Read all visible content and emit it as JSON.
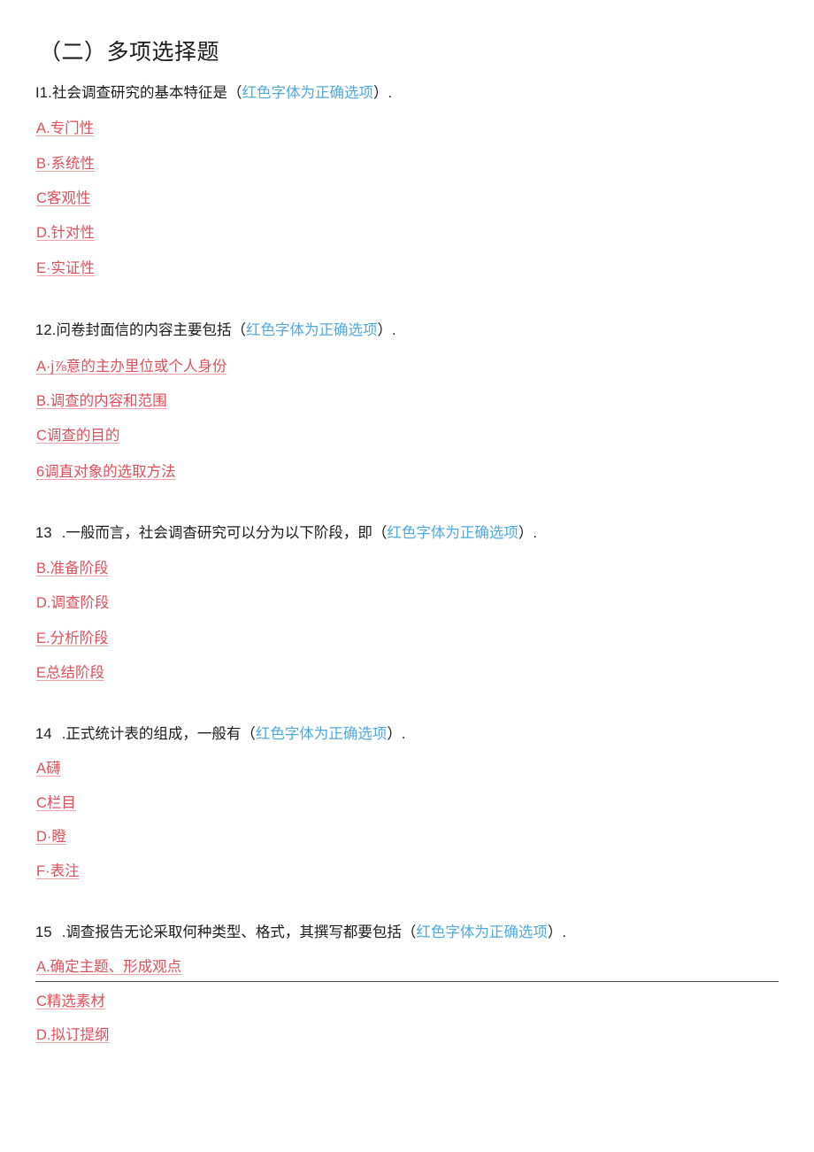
{
  "section": {
    "title": "（二）多项选择题"
  },
  "annotation": {
    "open_paren": "（",
    "text": "红色字体为正确选项",
    "close_paren": "）",
    "period": ".",
    "color": "#4fa9dd"
  },
  "option_color": "#e0505a",
  "questions": [
    {
      "number": "I1.",
      "stem": "社会调查研究的基本特征是",
      "spaced_number": false,
      "options": [
        {
          "label": "A.专门性",
          "underlined": true
        },
        {
          "label": "B·系统性",
          "underlined": true
        },
        {
          "label": "C客观性",
          "underlined": true
        },
        {
          "label": "D.针对性",
          "underlined": true
        },
        {
          "label": "E·实证性",
          "underlined": true
        }
      ]
    },
    {
      "number": "12.",
      "stem": "问卷封面信的内容主要包括",
      "spaced_number": false,
      "options": [
        {
          "label": "A·j⅞意的主办里位或个人身份",
          "underlined": true
        },
        {
          "label": "B.调查的内容和范围",
          "underlined": true
        },
        {
          "label": "C调查的目的",
          "underlined": true
        },
        {
          "label": "6调直对象的选取方法",
          "underlined": true
        }
      ]
    },
    {
      "number": "13",
      "stem": ".一般而言，社会调杳研究可以分为以下阶段，即",
      "spaced_number": true,
      "options": [
        {
          "label": "B.准备阶段",
          "underlined": true
        },
        {
          "label": "D.调查阶段",
          "underlined": false
        },
        {
          "label": "E.分析阶段",
          "underlined": true
        },
        {
          "label": "E总结阶段",
          "underlined": true
        }
      ]
    },
    {
      "number": "14",
      "stem": ".正式统计表的组成，一般有",
      "spaced_number": true,
      "options": [
        {
          "label": "A礴",
          "underlined": true
        },
        {
          "label": "C栏目",
          "underlined": true
        },
        {
          "label": "D·瞪",
          "underlined": true
        },
        {
          "label": "F·表注",
          "underlined": true
        }
      ]
    },
    {
      "number": "15",
      "stem": ".调查报告无论采取何种类型、格式，其撰写都要包括",
      "spaced_number": true,
      "options": [
        {
          "label": "A.确定主题、形成观点",
          "underlined": true
        },
        {
          "label": "C精选素材",
          "underlined": true
        },
        {
          "label": "D.拟订提纲",
          "underlined": true
        }
      ]
    }
  ]
}
